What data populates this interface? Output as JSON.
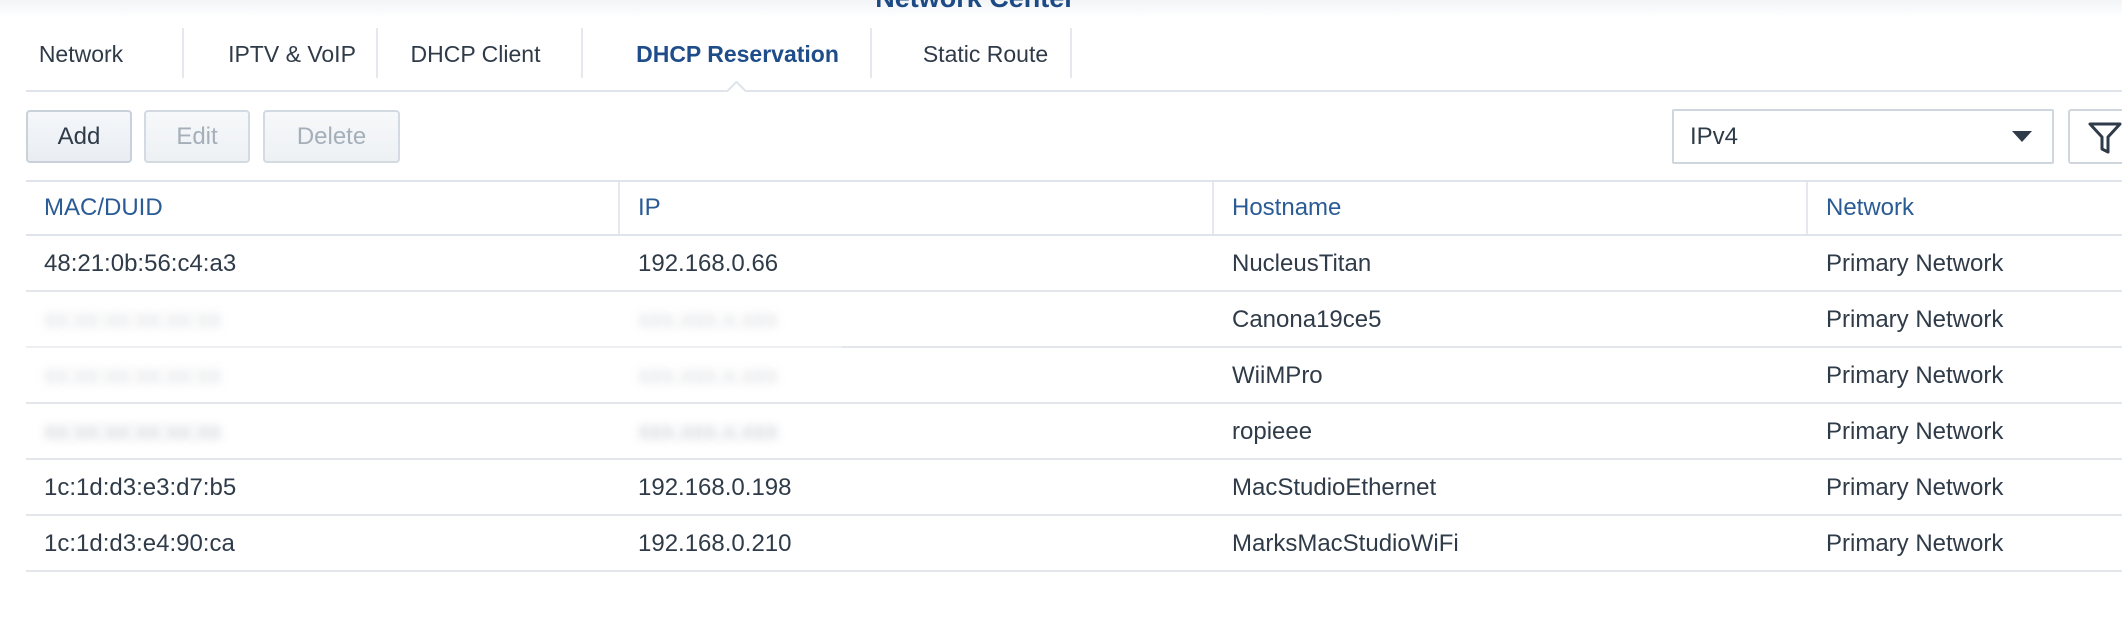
{
  "window": {
    "title": "Network Center"
  },
  "tabs": [
    {
      "label": "Network"
    },
    {
      "label": "IPTV & VoIP"
    },
    {
      "label": "DHCP Client"
    },
    {
      "label": "DHCP Reservation",
      "active": true
    },
    {
      "label": "Static Route"
    }
  ],
  "toolbar": {
    "add_label": "Add",
    "edit_label": "Edit",
    "delete_label": "Delete",
    "ip_version_selected": "IPv4",
    "filter_icon": "filter-icon"
  },
  "table": {
    "columns": [
      "MAC/DUID",
      "IP",
      "Hostname",
      "Network"
    ],
    "rows": [
      {
        "mac": "48:21:0b:56:c4:a3",
        "ip": "192.168.0.66",
        "hostname": "NucleusTitan",
        "network": "Primary Network"
      },
      {
        "mac": "",
        "ip": "",
        "hostname": "Canona19ce5",
        "network": "Primary Network"
      },
      {
        "mac": "",
        "ip": "",
        "hostname": "WiiMPro",
        "network": "Primary Network"
      },
      {
        "mac": "",
        "ip": "",
        "hostname": "ropieee",
        "network": "Primary Network"
      },
      {
        "mac": "1c:1d:d3:e3:d7:b5",
        "ip": "192.168.0.198",
        "hostname": "MacStudioEthernet",
        "network": "Primary Network"
      },
      {
        "mac": "1c:1d:d3:e4:90:ca",
        "ip": "192.168.0.210",
        "hostname": "MarksMacStudioWiFi",
        "network": "Primary Network"
      }
    ]
  },
  "colors": {
    "accent": "#1f4d8a",
    "header_text": "#2a5b95",
    "border": "#dfe4ea"
  }
}
